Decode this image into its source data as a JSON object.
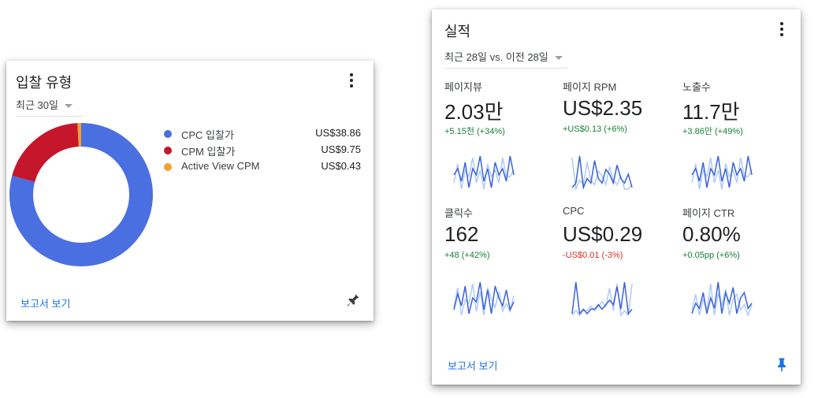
{
  "bid_card": {
    "title": "입찰 유형",
    "date_range": "최근 30일",
    "report_link": "보고서 보기",
    "items": [
      {
        "label": "CPC 입찰가",
        "value": "US$38.86",
        "amount": 38.86,
        "color": "#4a6fe0"
      },
      {
        "label": "CPM 입찰가",
        "value": "US$9.75",
        "amount": 9.75,
        "color": "#c5162b"
      },
      {
        "label": "Active View CPM",
        "value": "US$0.43",
        "amount": 0.43,
        "color": "#f2a22b"
      }
    ]
  },
  "perf_card": {
    "title": "실적",
    "date_range": "최근 28일 vs. 이전 28일",
    "report_link": "보고서 보기",
    "metrics": [
      {
        "name": "페이지뷰",
        "value": "2.03만",
        "change": "+5.15천 (+34%)",
        "trend": "up",
        "spark": [
          5,
          6,
          4,
          7,
          3,
          6,
          5,
          8,
          4,
          6,
          3,
          7,
          5,
          6,
          4,
          8,
          5
        ]
      },
      {
        "name": "페이지 RPM",
        "value": "US$2.35",
        "change": "+US$0.13 (+6%)",
        "trend": "up",
        "spark": [
          2,
          3,
          9,
          2,
          4,
          3,
          8,
          4,
          3,
          6,
          5,
          3,
          7,
          4,
          3,
          5,
          2
        ]
      },
      {
        "name": "노출수",
        "value": "11.7만",
        "change": "+3.86만 (+49%)",
        "trend": "up",
        "spark": [
          5,
          6,
          4,
          7,
          3,
          6,
          5,
          8,
          4,
          6,
          3,
          7,
          5,
          6,
          4,
          8,
          5
        ]
      },
      {
        "name": "클릭수",
        "value": "162",
        "change": "+48 (+42%)",
        "trend": "up",
        "spark": [
          3,
          7,
          4,
          9,
          2,
          6,
          5,
          10,
          3,
          8,
          2,
          9,
          6,
          4,
          8,
          3,
          5
        ]
      },
      {
        "name": "CPC",
        "value": "US$0.29",
        "change": "-US$0.01 (-3%)",
        "trend": "down",
        "spark": [
          2,
          9,
          2,
          3,
          2,
          3,
          3,
          4,
          3,
          4,
          5,
          4,
          8,
          3,
          9,
          2,
          3
        ]
      },
      {
        "name": "페이지 CTR",
        "value": "0.80%",
        "change": "+0.05pp (+6%)",
        "trend": "up",
        "spark": [
          3,
          5,
          4,
          7,
          3,
          6,
          4,
          9,
          3,
          7,
          5,
          8,
          3,
          6,
          7,
          4,
          5
        ]
      }
    ]
  }
}
